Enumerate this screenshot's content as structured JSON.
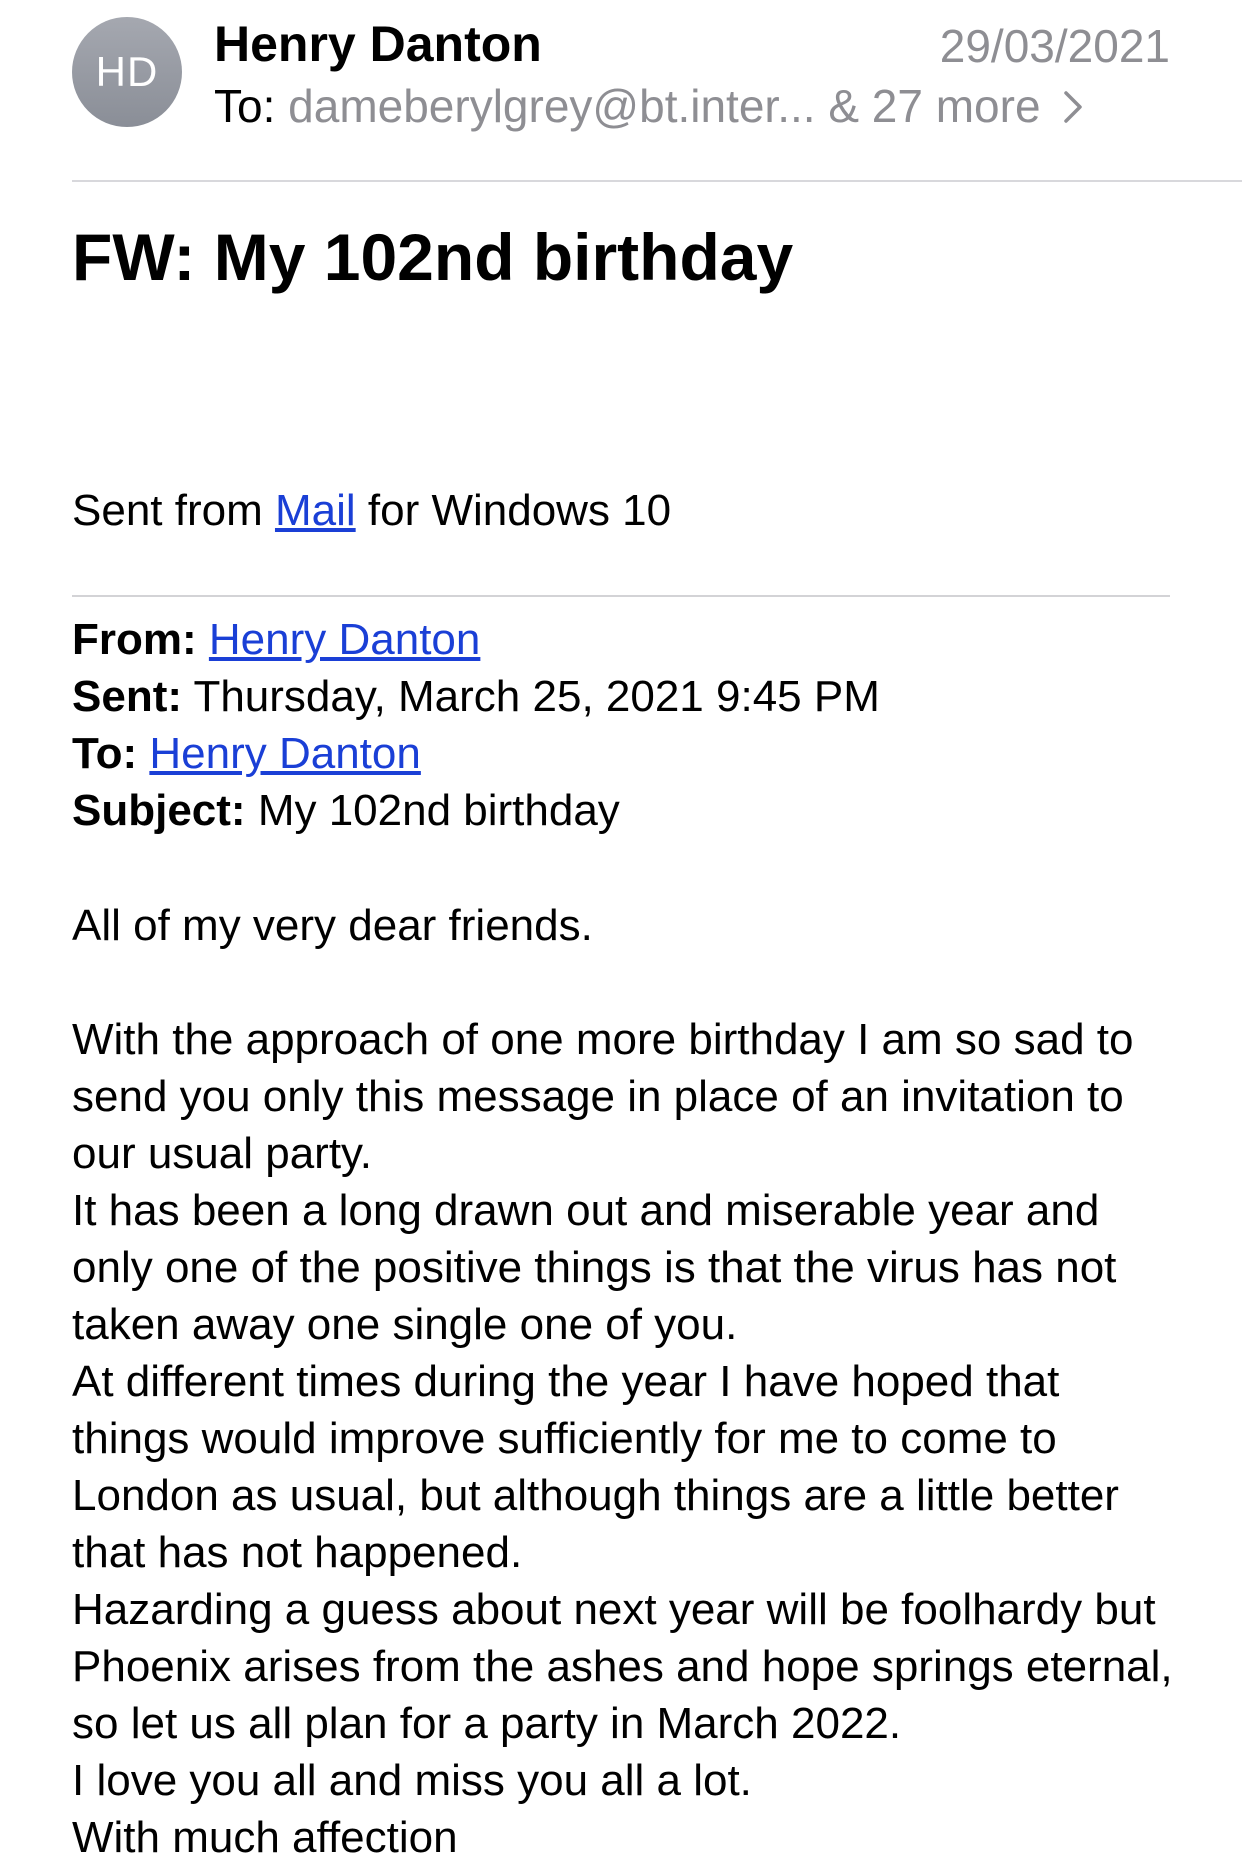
{
  "header": {
    "avatar_initials": "HD",
    "sender_name": "Henry Danton",
    "date": "29/03/2021",
    "to_label": "To:",
    "to_recipients": "dameberylgrey@bt.inter... & 27 more",
    "to_chevron_icon": "chevron-right-icon"
  },
  "subject": "FW: My 102nd birthday",
  "sent_from": {
    "prefix": "Sent from ",
    "link": "Mail",
    "suffix": " for Windows 10"
  },
  "forwarded": {
    "from_label": "From:",
    "from_value": "Henry Danton",
    "sent_label": "Sent:",
    "sent_value": "Thursday, March 25, 2021 9:45 PM",
    "to_label": "To:",
    "to_value": "Henry Danton",
    "subject_label": "Subject:",
    "subject_value": "My 102nd birthday"
  },
  "greeting": "All of my very dear friends.",
  "paragraphs": [
    "With the approach of one more birthday I am so sad to send you only this message in place of an invitation to our usual party.",
    "It has been a long drawn out and miserable year and only one of the positive things is that the virus has not taken away one single one of you.",
    "At different times during the year I have hoped that things would improve sufficiently for me to come to London as usual, but although things are a little better that has not happened.",
    "Hazarding a guess about next year will be foolhardy but Phoenix arises from the ashes and hope springs eternal, so let us all plan for a party in March 2022.",
    "I love you all and miss you all a lot.",
    "With much affection"
  ],
  "colors": {
    "link": "#1a3fd6",
    "secondary_text": "#8e8e93",
    "avatar_bg": "#9a9da5"
  }
}
